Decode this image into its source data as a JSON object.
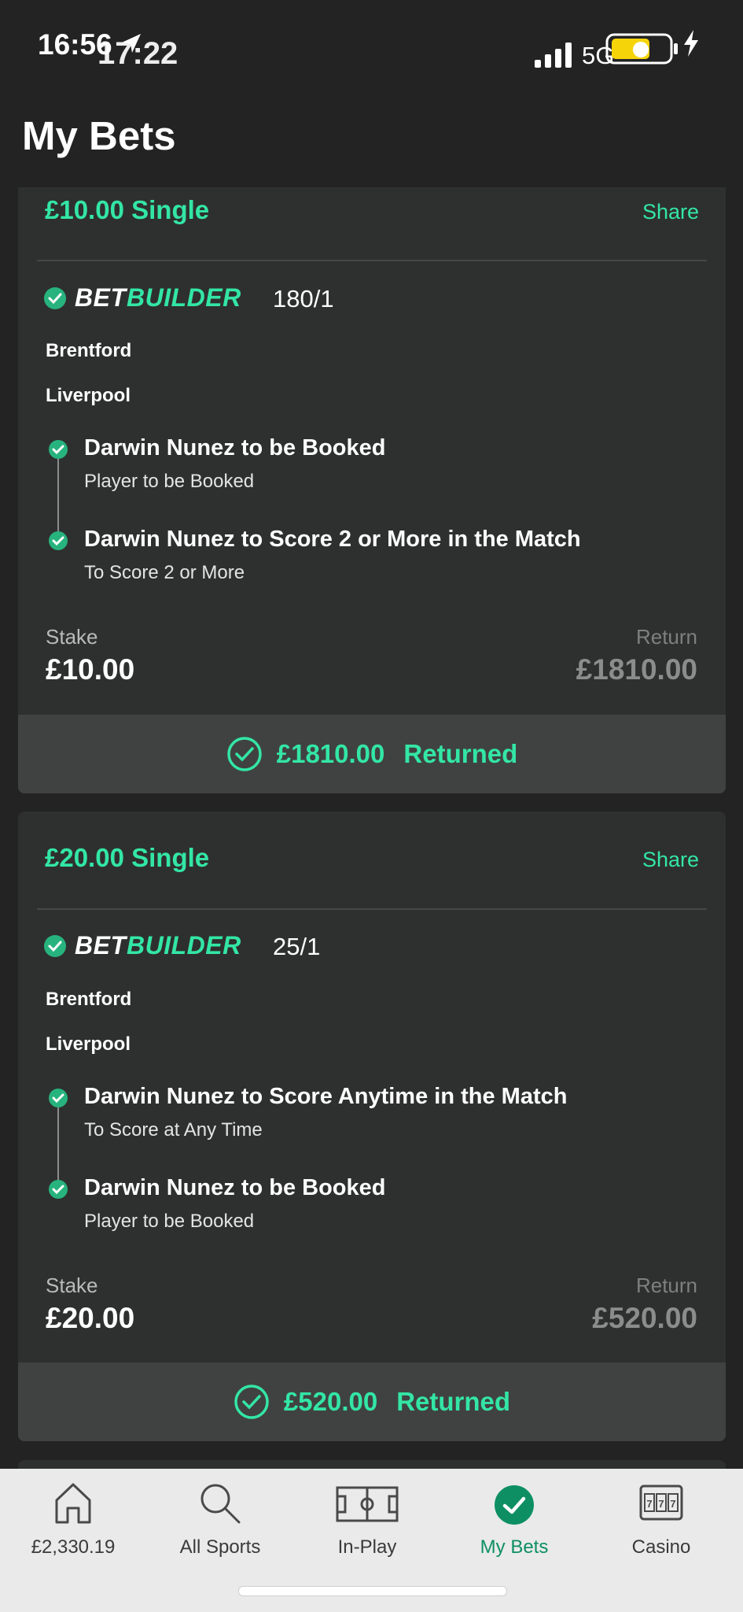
{
  "status_bar": {
    "time_old": "16:56",
    "time": "17:22",
    "network": "5G",
    "colors": {
      "battery": "#f5d40a"
    }
  },
  "page_title": "My Bets",
  "bets": [
    {
      "title": "£10.00 Single",
      "share": "Share",
      "builder_word1": "BET",
      "builder_word2": "BUILDER",
      "odds": "180/1",
      "teams": [
        "Brentford",
        "Liverpool"
      ],
      "legs": [
        {
          "title": "Darwin Nunez to be Booked",
          "sub": "Player to be Booked"
        },
        {
          "title": "Darwin Nunez to Score 2 or More in the Match",
          "sub": "To Score 2 or More"
        }
      ],
      "stake_label": "Stake",
      "stake": "£10.00",
      "return_label": "Return",
      "return": "£1810.00",
      "returned_amount": "£1810.00",
      "returned_text": "Returned"
    },
    {
      "title": "£20.00 Single",
      "share": "Share",
      "builder_word1": "BET",
      "builder_word2": "BUILDER",
      "odds": "25/1",
      "teams": [
        "Brentford",
        "Liverpool"
      ],
      "legs": [
        {
          "title": "Darwin Nunez to Score Anytime in the Match",
          "sub": "To Score at Any Time"
        },
        {
          "title": "Darwin Nunez to be Booked",
          "sub": "Player to be Booked"
        }
      ],
      "stake_label": "Stake",
      "stake": "£20.00",
      "return_label": "Return",
      "return": "£520.00",
      "returned_amount": "£520.00",
      "returned_text": "Returned"
    }
  ],
  "nav": [
    {
      "label": "£2,330.19",
      "icon": "home-icon"
    },
    {
      "label": "All Sports",
      "icon": "search-icon"
    },
    {
      "label": "In-Play",
      "icon": "pitch-icon"
    },
    {
      "label": "My Bets",
      "icon": "check-circle-icon",
      "active": true
    },
    {
      "label": "Casino",
      "icon": "slot-machine-icon"
    }
  ],
  "colors": {
    "accent": "#33e6a5",
    "active_nav": "#0e8f63",
    "background": "#232323",
    "card": "#2e302f"
  }
}
